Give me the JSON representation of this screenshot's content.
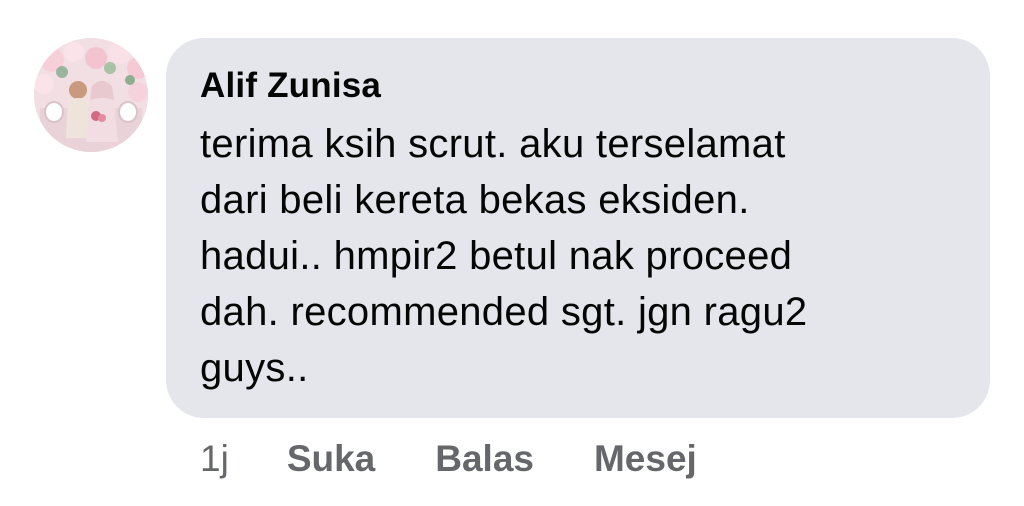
{
  "comment": {
    "author": "Alif Zunisa",
    "text": "terima ksih scrut. aku terselamat\ndari beli kereta bekas eksiden.\nhadui.. hmpir2 betul nak proceed\ndah. recommended sgt. jgn ragu2\nguys..",
    "time": "1j",
    "actions": {
      "like": "Suka",
      "reply": "Balas",
      "message": "Mesej"
    }
  },
  "colors": {
    "bubble": "#e4e6eb",
    "text": "#050505",
    "meta": "#65676b"
  }
}
